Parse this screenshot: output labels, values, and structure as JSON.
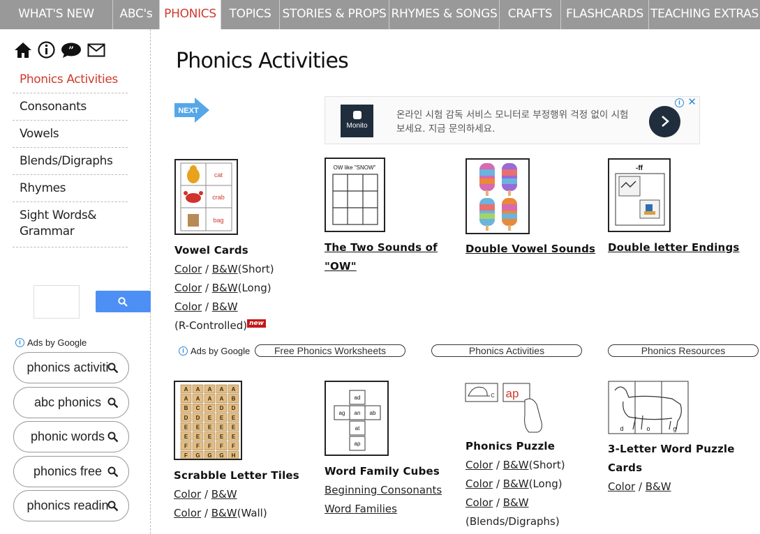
{
  "topnav": {
    "tabs": [
      {
        "label": "WHAT'S NEW"
      },
      {
        "label": "ABC's"
      },
      {
        "label": "PHONICS",
        "active": true
      },
      {
        "label": "TOPICS"
      },
      {
        "label": "STORIES & PROPS"
      },
      {
        "label": "RHYMES & SONGS"
      },
      {
        "label": "CRAFTS"
      },
      {
        "label": "FLASHCARDS"
      },
      {
        "label": "TEACHING EXTRAS"
      }
    ]
  },
  "sidebar": {
    "icons": [
      "home-icon",
      "info-icon",
      "speech-bubble-icon",
      "mail-icon"
    ],
    "items": [
      {
        "label": "Phonics Activities",
        "active": true
      },
      {
        "label": "Consonants"
      },
      {
        "label": "Vowels"
      },
      {
        "label": "Blends/Digraphs"
      },
      {
        "label": "Rhymes"
      },
      {
        "label": "Sight Words&\nGrammar"
      }
    ],
    "ads_label": "Ads by Google",
    "ad_pills": [
      "phonics activiti",
      "abc phonics",
      "phonic words",
      "phonics free",
      "phonics readin"
    ]
  },
  "main": {
    "title": "Phonics Activities",
    "next_label": "NEXT",
    "ad": {
      "logo_text": "Monito",
      "text": "온라인 시험 감독 서비스 모니터로 부정행위 걱정 없이 시험 보세요. 지금 문의하세요."
    },
    "cards_row1": [
      {
        "title": "Vowel Cards",
        "thumb_words": [
          "cat",
          "crab",
          "bag"
        ],
        "links": [
          {
            "a": "Color",
            "sep": " / ",
            "b": "B&W",
            "suffix": "(Short)"
          },
          {
            "a": "Color",
            "sep": " / ",
            "b": "B&W",
            "suffix": "(Long)"
          },
          {
            "a": "Color",
            "sep": " / ",
            "b": "B&W",
            "suffix": ""
          }
        ],
        "extra": "(R-Controlled)",
        "badge": "new"
      },
      {
        "title_line1": "The Two Sounds of",
        "title_line2": "\"OW\"",
        "thumb_header": "OW like \"SNOW\""
      },
      {
        "title": "Double Vowel Sounds"
      },
      {
        "title": "Double letter Endings",
        "thumb_header": "-ff"
      }
    ],
    "ads_row": {
      "label": "Ads by Google",
      "pills": [
        "Free Phonics Worksheets",
        "Phonics Activities",
        "Phonics Resources"
      ]
    },
    "cards_row2": [
      {
        "title": "Scrabble Letter Tiles",
        "tiles": [
          "A",
          "A",
          "A",
          "A",
          "A",
          "A",
          "A",
          "A",
          "A",
          "B",
          "B",
          "C",
          "C",
          "D",
          "D",
          "D",
          "D",
          "E",
          "E",
          "E",
          "E",
          "E",
          "E",
          "E",
          "E",
          "E",
          "E",
          "E",
          "E",
          "E",
          "F",
          "F",
          "F",
          "F",
          "F",
          "F",
          "G",
          "G",
          "G",
          "H"
        ],
        "links": [
          {
            "a": "Color",
            "sep": " / ",
            "b": "B&W",
            "suffix": ""
          },
          {
            "a": "Color",
            "sep": " / ",
            "b": "B&W",
            "suffix": "(Wall)"
          }
        ]
      },
      {
        "title": "Word Family Cubes",
        "cube_faces": [
          "ad",
          "ag",
          "an",
          "ab",
          "at",
          "ap"
        ],
        "links": [
          "Beginning Consonants",
          "Word Families"
        ]
      },
      {
        "title": "Phonics Puzzle",
        "puzzle_letters": [
          "c",
          "ap"
        ],
        "links": [
          {
            "a": "Color",
            "sep": " / ",
            "b": "B&W",
            "suffix": "(Short)"
          },
          {
            "a": "Color",
            "sep": " / ",
            "b": "B&W",
            "suffix": "(Long)"
          },
          {
            "a": "Color",
            "sep": " / ",
            "b": "B&W",
            "suffix": ""
          }
        ],
        "extra": "(Blends/Digraphs)"
      },
      {
        "title_line1": "3-Letter Word Puzzle",
        "title_line2": "Cards",
        "puzzle_letters": [
          "d",
          "o",
          "g"
        ],
        "links": [
          {
            "a": "Color",
            "sep": " / ",
            "b": "B&W",
            "suffix": ""
          }
        ]
      }
    ]
  },
  "colors": {
    "nav_bg": "#999999",
    "accent_red": "#d03a2c",
    "search_blue": "#4d8ff5",
    "ad_dark": "#1f2d3d"
  }
}
